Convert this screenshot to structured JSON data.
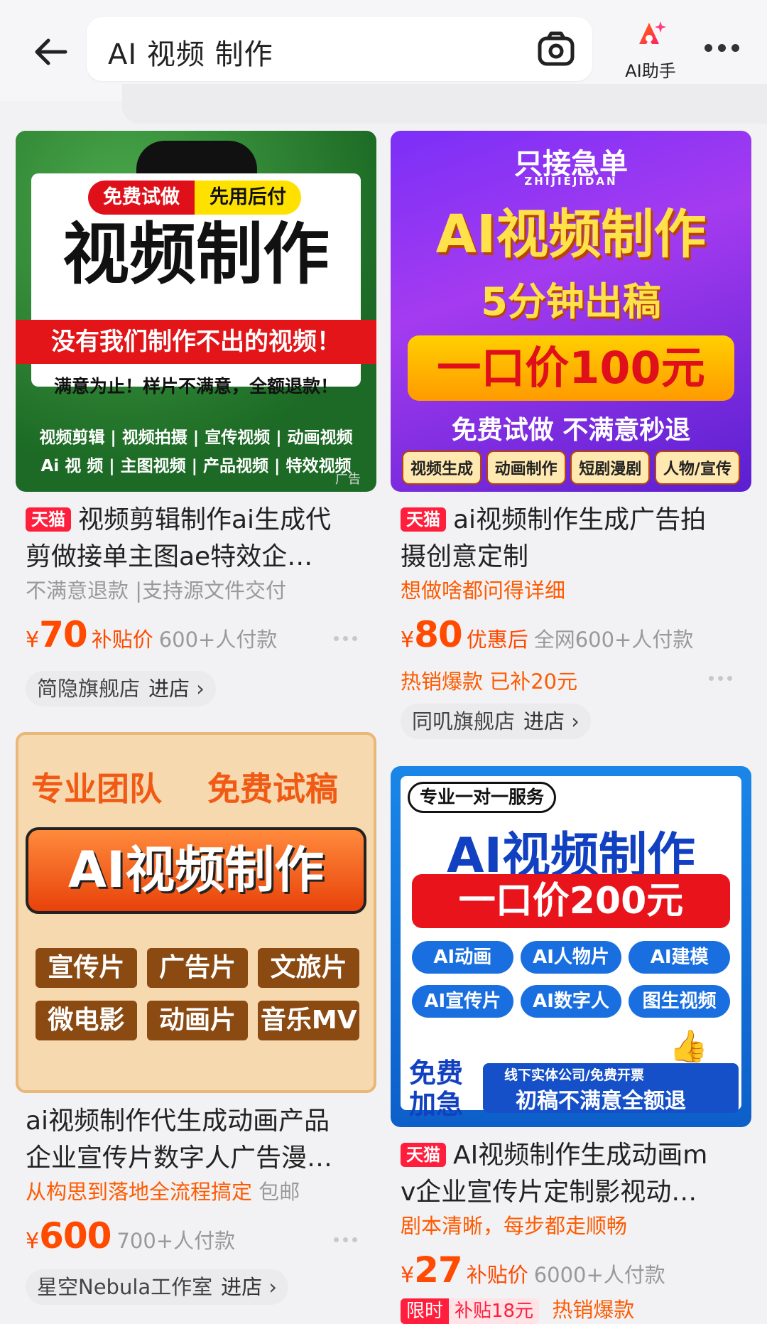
{
  "header": {
    "search_query": "AI 视频 制作",
    "ai_assistant_label": "AI助手"
  },
  "products": [
    {
      "poster": {
        "badge_left": "免费试做",
        "badge_right": "先用后付",
        "headline": "视频制作",
        "red_banner": "没有我们制作不出的视频！",
        "guarantee": "满意为止！样片不满意，全额退款！",
        "services_row1": "视频剪辑 | 视频拍摄 | 宣传视频 | 动画视频",
        "services_row2": "Ai 视 频 | 主图视频 | 产品视频 | 特效视频",
        "ad_mark": "广告"
      },
      "store_tag": "天猫",
      "title_line1": "视频剪辑制作ai生成代",
      "title_line2": "剪做接单主图ae特效企…",
      "subtitle": "不满意退款 |支持源文件交付",
      "currency": "¥",
      "price": "70",
      "price_tag": "补贴价",
      "payers": "600+人付款",
      "shop_name": "简隐旗舰店",
      "shop_action": "进店"
    },
    {
      "poster": {
        "top": "只接急单",
        "top_sub": "ZHIJIEJIDAN",
        "headline": "AI视频制作",
        "line2": "5分钟出稿",
        "price_line": "一口价100元",
        "line4": "免费试做 不满意秒退",
        "chips": [
          "视频生成",
          "动画制作",
          "短剧漫剧",
          "人物/宣传"
        ]
      },
      "store_tag": "天猫",
      "title_line1": "ai视频制作生成广告拍",
      "title_line2": "摄创意定制",
      "subtitle": "想做啥都问得详细",
      "currency": "¥",
      "price": "80",
      "price_tag": "优惠后",
      "payers": "全网600+人付款",
      "hot_text": "热销爆款  已补20元",
      "shop_name": "同叽旗舰店",
      "shop_action": "进店"
    },
    {
      "poster": {
        "top_left": "专业团队",
        "top_right": "免费试稿",
        "headline": "AI视频制作",
        "chips": [
          "宣传片",
          "广告片",
          "文旅片",
          "微电影",
          "动画片",
          "音乐MV"
        ]
      },
      "title_line1": "ai视频制作代生成动画产品",
      "title_line2": "企业宣传片数字人广告漫…",
      "subtitle_orange": "从构思到落地全流程搞定",
      "subtitle_gray": "包邮",
      "currency": "¥",
      "price": "600",
      "payers": "700+人付款",
      "shop_name": "星空Nebula工作室",
      "shop_action": "进店"
    },
    {
      "poster": {
        "top_badge": "专业一对一服务",
        "headline": "AI视频制作",
        "price_line": "一口价200元",
        "chips": [
          "AI动画",
          "AI人物片",
          "AI建模",
          "AI宣传片",
          "AI数字人",
          "图生视频"
        ],
        "bottom_left": "免费加急",
        "bottom_small": "线下实体公司/免费开票",
        "bottom_right": "初稿不满意全额退"
      },
      "store_tag": "天猫",
      "title_line1": "AI视频制作生成动画m",
      "title_line2": "v企业宣传片定制影视动…",
      "subtitle": "剧本清晰，每步都走顺畅",
      "currency": "¥",
      "price": "27",
      "price_tag": "补贴价",
      "payers": "6000+人付款",
      "promo_badge": "限时",
      "promo_text": "补贴18元",
      "hot_text": "热销爆款"
    }
  ],
  "colors": {
    "price_orange": "#ff4a00",
    "tmall_red": "#ff1e3c",
    "accent_orange": "#ff5a00"
  }
}
